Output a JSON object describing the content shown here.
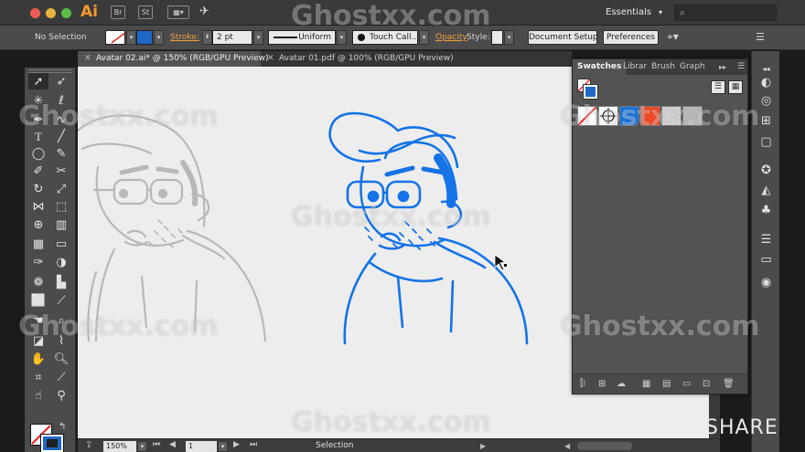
{
  "app": {
    "logo": "Ai",
    "workspace": "Essentials",
    "bridge_label": "Br",
    "stock_label": "St"
  },
  "control_bar": {
    "selection": "No Selection",
    "stroke_label": "Stroke:",
    "stroke_weight": "2 pt",
    "profile": "Uniform",
    "brush": "Touch Call...",
    "opacity_label": "Opacity",
    "style_label": "Style:",
    "document_setup": "Document Setup",
    "preferences": "Preferences"
  },
  "tabs": [
    {
      "label": "Avatar 02.ai* @ 150% (RGB/GPU Preview)",
      "active": true
    },
    {
      "label": "Avatar 01.pdf @ 100% (RGB/GPU Preview)",
      "active": false
    }
  ],
  "status_bar": {
    "zoom": "150%",
    "artboard": "1",
    "status": "Selection"
  },
  "panel": {
    "tabs": [
      "Swatches",
      "Librar",
      "Brush",
      "Graph"
    ],
    "swatch_colors": [
      "#ffffff",
      "#ffffff",
      "#1a73d9",
      "#f04a26",
      "#c8c8c8",
      "#b0b0b0"
    ]
  },
  "colors": {
    "accent_blue": "#1473e6",
    "sketch_gray": "#b8b8b8",
    "ai_orange": "#f39a2b"
  },
  "icons": {
    "tools": [
      "selection-tool-icon",
      "direct-selection-tool-icon",
      "magic-wand-icon",
      "lasso-icon",
      "pen-tool-icon",
      "curvature-tool-icon",
      "type-tool-icon",
      "line-tool-icon",
      "ellipse-tool-icon",
      "paintbrush-icon",
      "shaper-tool-icon",
      "eraser-icon",
      "rotate-tool-icon",
      "scale-tool-icon",
      "width-tool-icon",
      "free-transform-icon",
      "shape-builder-icon",
      "perspective-grid-icon",
      "mesh-tool-icon",
      "gradient-tool-icon",
      "eyedropper-icon",
      "blend-tool-icon",
      "symbol-sprayer-icon",
      "column-graph-icon",
      "artboard-tool-icon",
      "slice-tool-icon",
      "hand-tool-icon",
      "zoom-tool-icon"
    ]
  },
  "overlay": {
    "share": "SHARE",
    "watermark": "Ghostxx.com"
  }
}
